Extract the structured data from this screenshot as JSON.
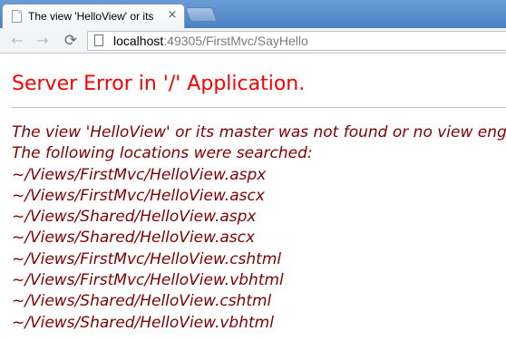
{
  "tab": {
    "title": "The view 'HelloView' or its master",
    "close_glyph": "×"
  },
  "toolbar": {
    "back_glyph": "←",
    "forward_glyph": "→",
    "reload_glyph": "⟳",
    "url_host": "localhost",
    "url_rest": ":49305/FirstMvc/SayHello"
  },
  "page": {
    "error_title": "Server Error in '/' Application.",
    "message_lines": [
      "The view 'HelloView' or its master was not found or no view engine",
      "The following locations were searched:",
      "~/Views/FirstMvc/HelloView.aspx",
      "~/Views/FirstMvc/HelloView.ascx",
      "~/Views/Shared/HelloView.aspx",
      "~/Views/Shared/HelloView.ascx",
      "~/Views/FirstMvc/HelloView.cshtml",
      "~/Views/FirstMvc/HelloView.vbhtml",
      "~/Views/Shared/HelloView.cshtml",
      "~/Views/Shared/HelloView.vbhtml"
    ]
  },
  "colors": {
    "title_red": "#ff0000",
    "message_maroon": "#800000",
    "tabstrip_blue": "#4f86c6"
  }
}
